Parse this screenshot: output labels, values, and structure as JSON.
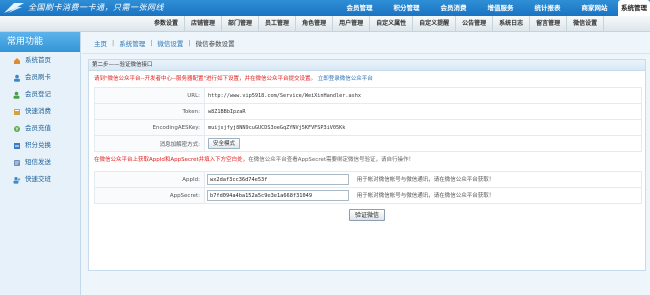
{
  "header": {
    "slogan": "全国刷卡消费一卡通，只需一张网线",
    "nav": [
      "会员管理",
      "积分管理",
      "会员消费",
      "增值服务",
      "统计报表",
      "商家网站",
      "系统管理"
    ],
    "active_nav": "系统管理"
  },
  "subnav": [
    "参数设置",
    "店铺管理",
    "部门管理",
    "员工管理",
    "角色管理",
    "用户管理",
    "自定义属性",
    "自定义提醒",
    "公告管理",
    "系统日志",
    "留言管理",
    "微信设置"
  ],
  "sidebar": {
    "title": "常用功能",
    "items": [
      {
        "label": "系统首页",
        "icon": "home-icon"
      },
      {
        "label": "会员刷卡",
        "icon": "member-card-icon"
      },
      {
        "label": "会员登记",
        "icon": "member-register-icon"
      },
      {
        "label": "快速消费",
        "icon": "quick-consume-icon"
      },
      {
        "label": "会员充值",
        "icon": "recharge-icon"
      },
      {
        "label": "积分兑换",
        "icon": "points-exchange-icon"
      },
      {
        "label": "短信发送",
        "icon": "sms-icon"
      },
      {
        "label": "快速交班",
        "icon": "shift-handover-icon"
      }
    ]
  },
  "breadcrumb": {
    "home": "主页",
    "level1": "系统管理",
    "level2": "微信设置",
    "current": "微信参数设置"
  },
  "panel": {
    "title": "第二步——验证微信接口",
    "notice": "请到\"微信公众平台--开发者中心--服务器配置\"进行如下设置，并在微信公众平台提交设置。",
    "notice_link": "立即登录微信公众平台",
    "fields": [
      {
        "label": "URL:",
        "value": "http://www.vip5918.com/Service/WeiXinHandler.ashx"
      },
      {
        "label": "Token:",
        "value": "w8Z1BBbIpzaR"
      },
      {
        "label": "EncodingAESKey:",
        "value": "muijsjfyj8NN9cuGUCDS3oeGqZYNVj5KFVFSP3iV05Kk"
      },
      {
        "label": "消息加解密方式:",
        "value": "安全模式"
      }
    ],
    "notice2_red": "在微信公众平台上获取AppId和AppSecret并填入下方空白处，",
    "notice2_gray": "在微信公众平台查看AppSecret需要绑定微信号验证，请自行操作！",
    "app_fields": [
      {
        "label": "AppId:",
        "value": "wx2daf3cc36d74e53f",
        "hint": "用于帐对微信帐号与微信通讯，请在微信公众平台获取！"
      },
      {
        "label": "AppSecret:",
        "value": "b7fd094a4ba152a5c9e3e1a668f31049",
        "hint": "用于帐对微信帐号与微信通讯，请在微信公众平台获取！"
      }
    ],
    "submit_label": "验证微信"
  },
  "colors": {
    "banner": "#2f8fd6",
    "sidebar_title": "#3395d6",
    "notice_red": "#e01b1b",
    "link": "#2b72b3"
  }
}
